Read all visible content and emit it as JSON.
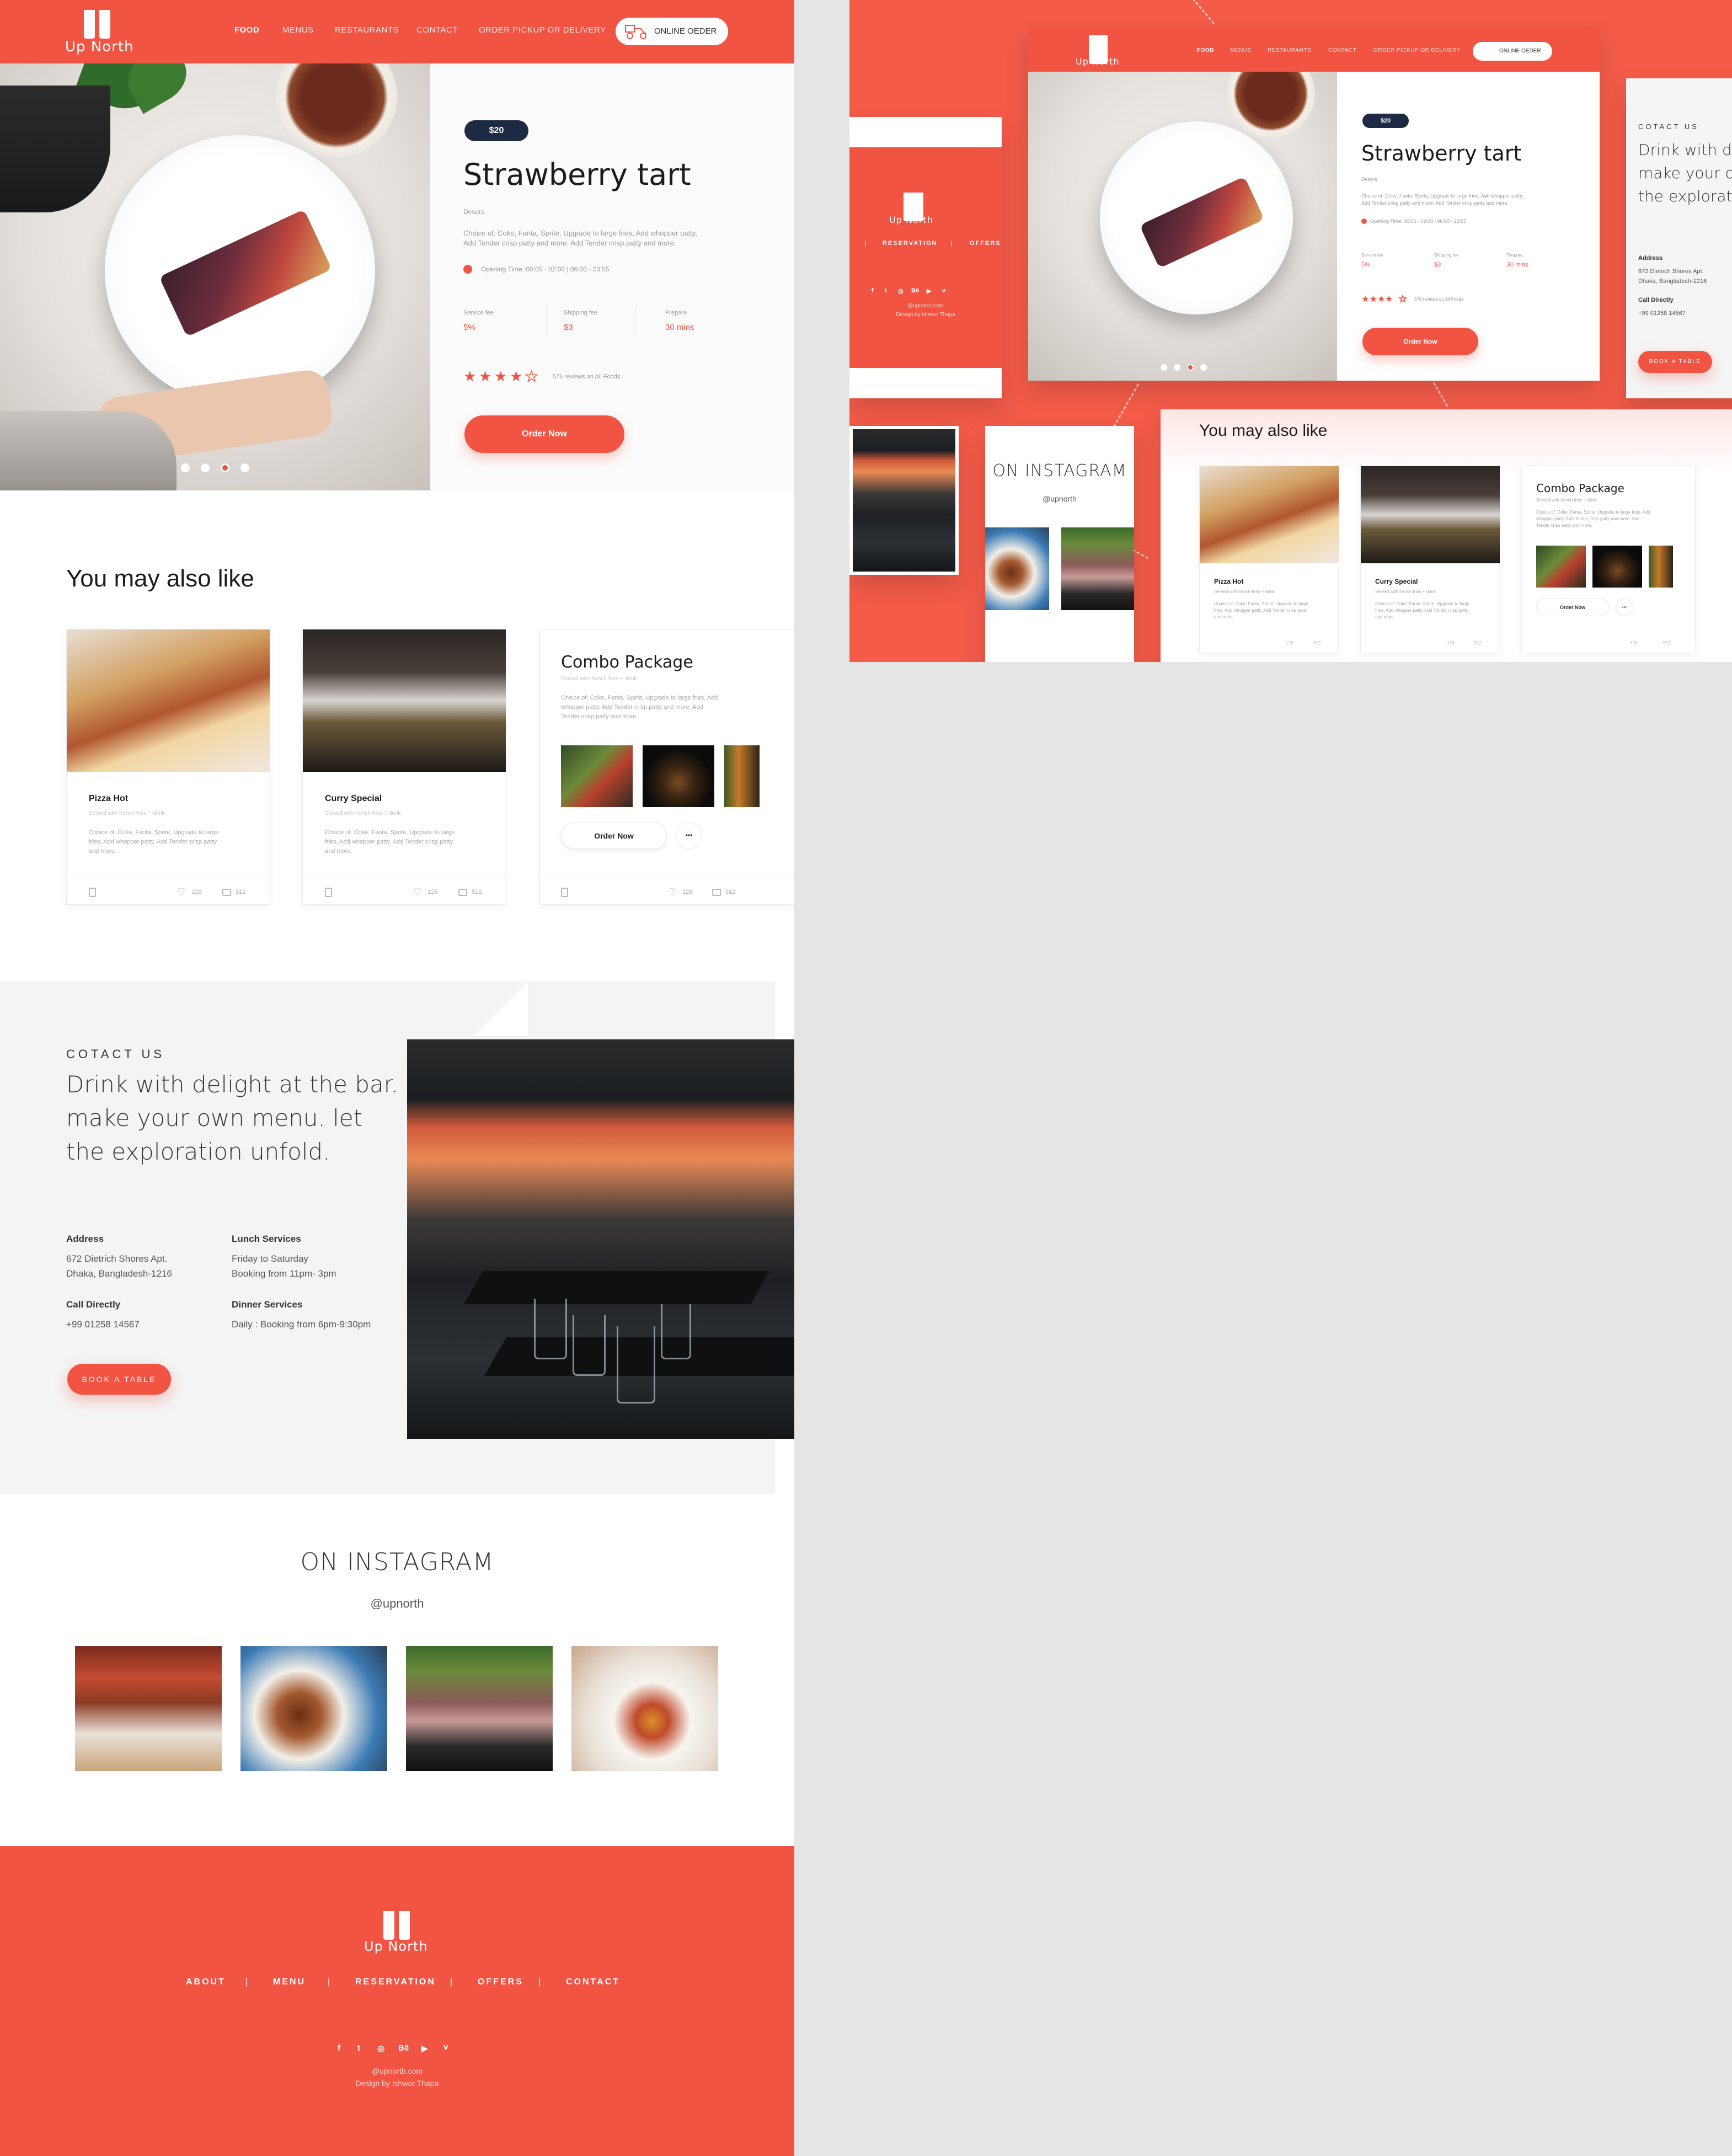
{
  "brand": {
    "name": "Up North"
  },
  "nav": {
    "items": [
      "FOOD",
      "MENUS",
      "RESTAURANTS",
      "CONTACT",
      "ORDER PICKUP OR DELIVERY"
    ],
    "online_order": "ONLINE OEDER"
  },
  "hero": {
    "price": "$20",
    "title": "Strawberry tart",
    "category": "Desers",
    "description_1": "Choice of: Coke, Fanta, Sprite, Upgrade to large fries, Add whopper patty,",
    "description_2": "Add Tender crisp patty and more. Add Tender crisp patty and more.",
    "opening": "Opening Time: 00:05 - 02:00 | 06:00 - 23:55",
    "stats": [
      {
        "label": "Service fee",
        "value": "5%"
      },
      {
        "label": "Shipping fee",
        "value": "$3"
      },
      {
        "label": "Prepare",
        "value": "30 mins"
      }
    ],
    "rating": 4,
    "reviews": "576 reviews on All Foods",
    "order_label": "Order Now",
    "slides": 4,
    "active_slide": 3
  },
  "also_like": {
    "heading": "You may also like",
    "cards": [
      {
        "name": "Pizza Hot",
        "sub": "Served with french fries + drink",
        "desc_1": "Choice of: Coke, Fanta, Sprite, Upgrade to large",
        "desc_2": "fries, Add whopper patty, Add Tender crisp patty",
        "desc_3": "and more.",
        "likes": "128",
        "comments": "512"
      },
      {
        "name": "Curry Special",
        "sub": "Served with french fries + drink",
        "desc_1": "Choice of: Coke, Fanta, Sprite, Upgrade to large",
        "desc_2": "fries, Add whopper patty, Add Tender crisp patty",
        "desc_3": "and more.",
        "likes": "128",
        "comments": "512"
      }
    ],
    "combo": {
      "name": "Combo Package",
      "sub": "Served with french fries + drink",
      "desc_1": "Choice of: Coke, Fanta, Sprite, Upgrade to large fries, Add",
      "desc_2": "whopper patty, Add Tender crisp patty and more. Add",
      "desc_3": "Tender crisp patty and more.",
      "order_label": "Order Now",
      "more_label": "•••",
      "likes": "128",
      "comments": "512"
    }
  },
  "contact": {
    "label": "COTACT US",
    "headline_1": "Drink with delight at the bar.",
    "headline_2": "make your own menu. let",
    "headline_3": "the exploration unfold.",
    "address_h": "Address",
    "address_1": "672 Dietrich Shores Apt.",
    "address_2": "Dhaka, Bangladesh-1216",
    "call_h": "Call Directly",
    "call": "+99 01258 14567",
    "lunch_h": "Lunch Services",
    "lunch_1": "Friday to Saturday",
    "lunch_2": "Booking from 11pm- 3pm",
    "dinner_h": "Dinner Services",
    "dinner": "Daily : Booking from 6pm-9:30pm",
    "book_label": "BOOK A TABLE"
  },
  "instagram": {
    "heading": "ON INSTAGRAM",
    "handle": "@upnorth"
  },
  "footer": {
    "links": [
      "ABOUT",
      "MENU",
      "RESERVATION",
      "OFFERS",
      "CONTACT"
    ],
    "socials": [
      "f",
      "t",
      "◎",
      "Bē",
      "▶",
      "v"
    ],
    "email": "@upnorth.com",
    "credit": "Design by Ishwor Thapa",
    "mini_links": [
      "RESERVATION",
      "OFFERS"
    ],
    "mini_sep": "|"
  },
  "colors": {
    "accent": "#f25444",
    "navy": "#1e2a44",
    "panel": "#f45b49"
  }
}
